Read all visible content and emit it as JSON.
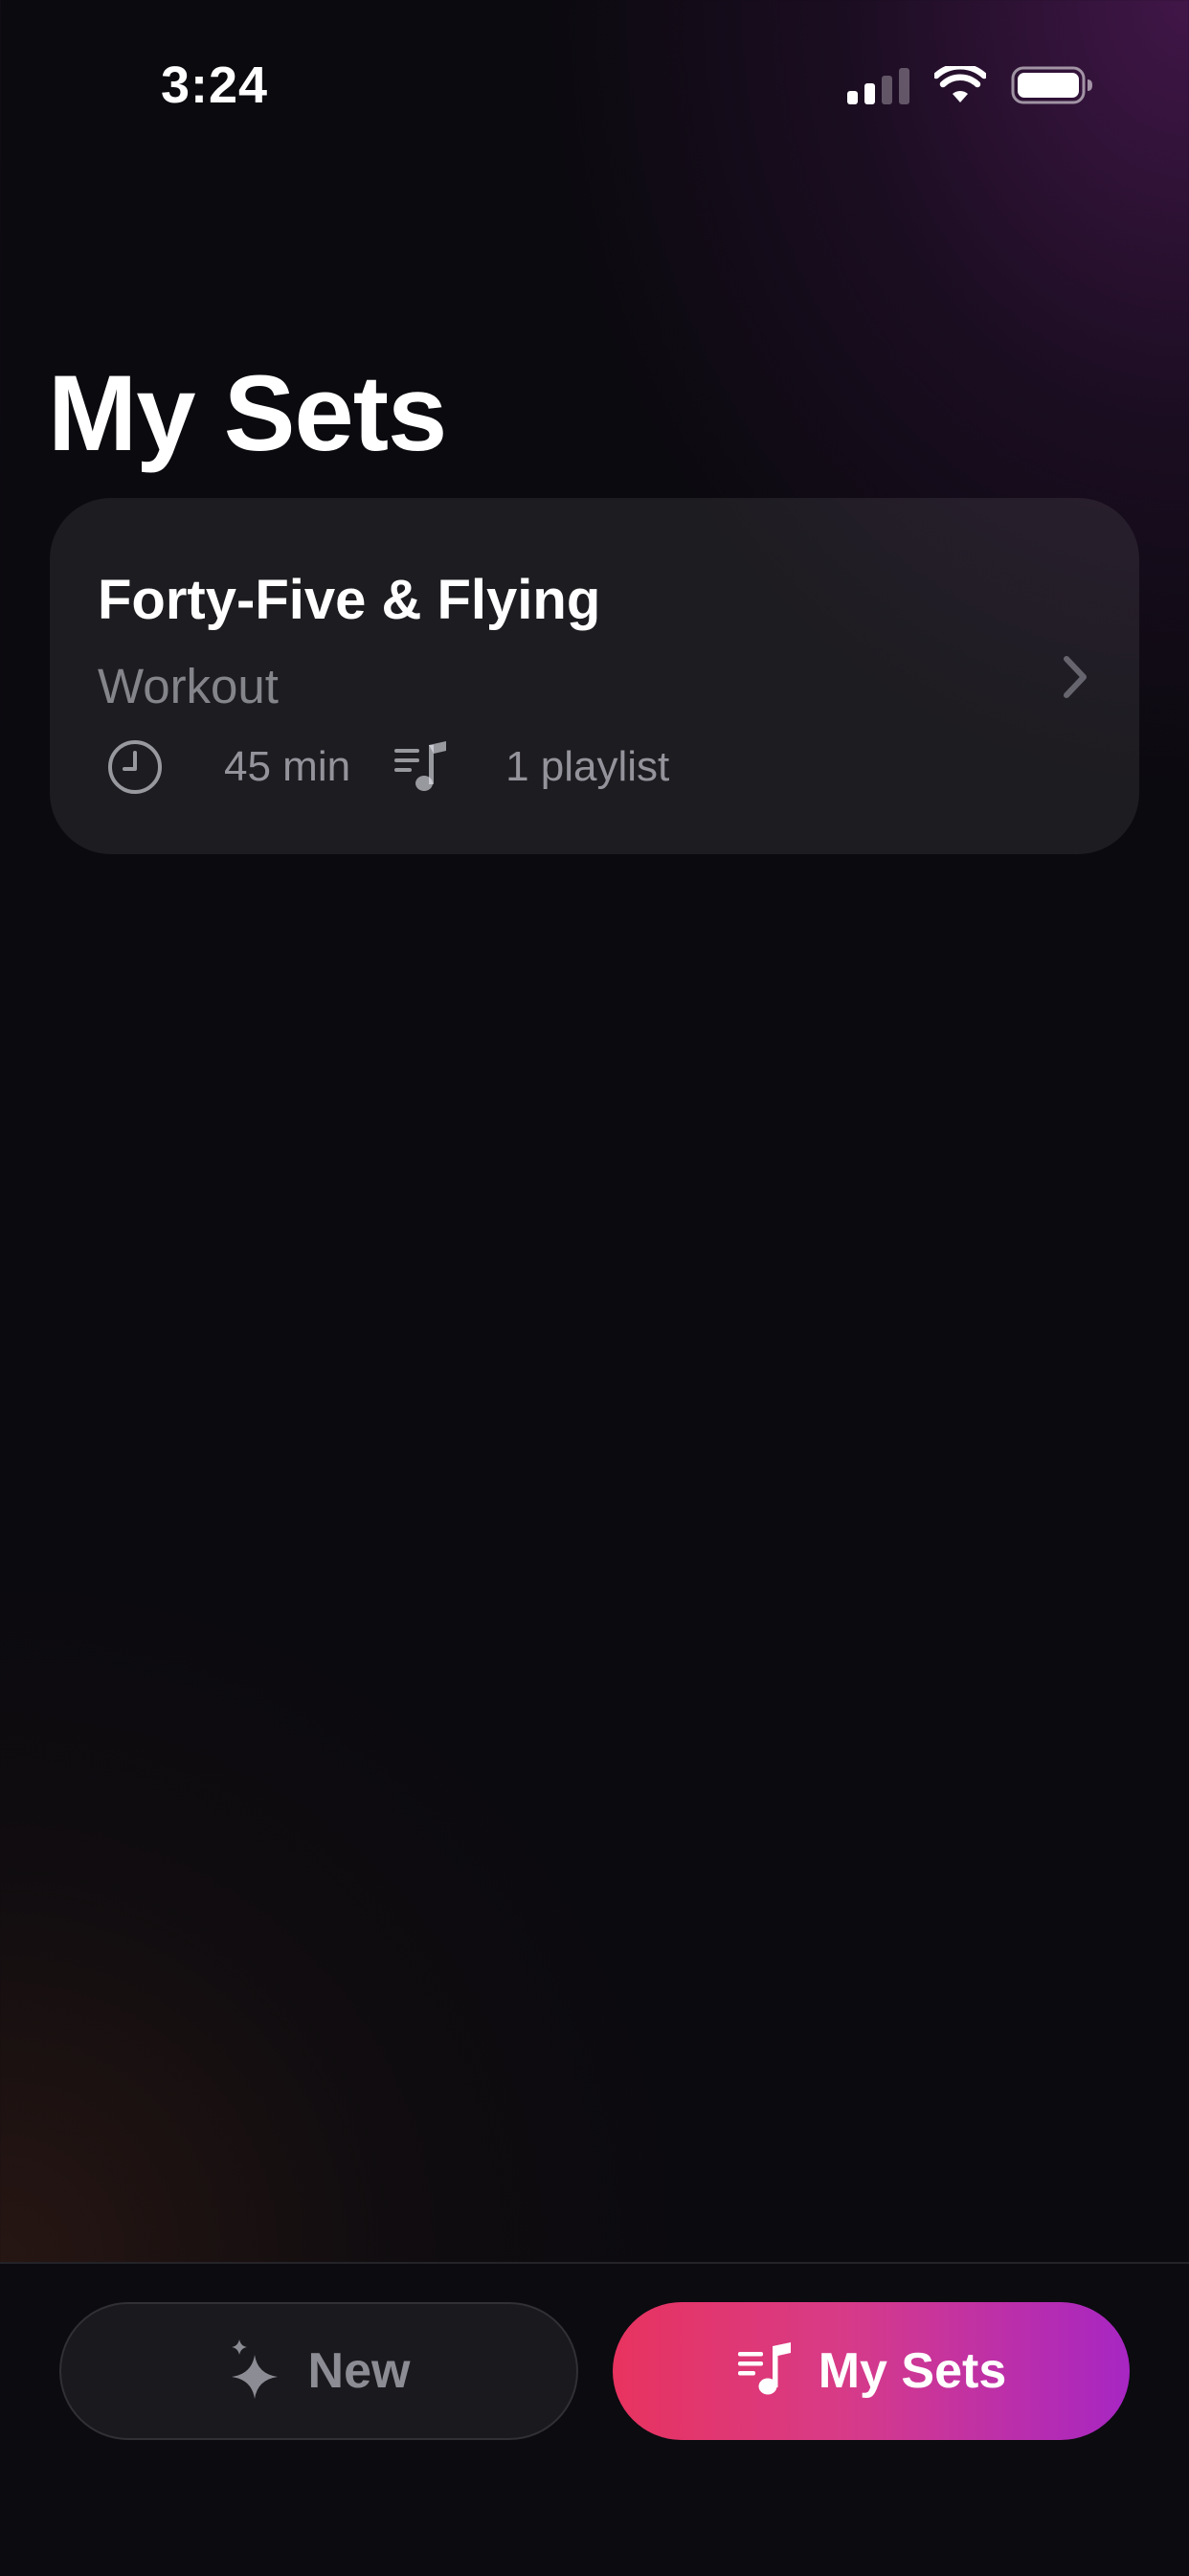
{
  "status_bar": {
    "time": "3:24",
    "icons": [
      "cellular-signal-icon",
      "wifi-icon",
      "battery-icon"
    ]
  },
  "page": {
    "title": "My Sets"
  },
  "sets": [
    {
      "title": "Forty-Five & Flying",
      "category": "Workout",
      "duration": "45 min",
      "playlists": "1 playlist",
      "icons": [
        "clock-icon",
        "music-list-icon",
        "chevron-right-icon"
      ]
    }
  ],
  "bottom_bar": {
    "new_label": "New",
    "new_icon": "sparkles-icon",
    "my_sets_label": "My Sets",
    "my_sets_icon": "music-list-icon",
    "active_tab": "My Sets"
  },
  "colors": {
    "background": "#0b0a0f",
    "card": "#1a181e",
    "accent_gradient_start": "#e8335f",
    "accent_gradient_end": "#a726c3"
  }
}
